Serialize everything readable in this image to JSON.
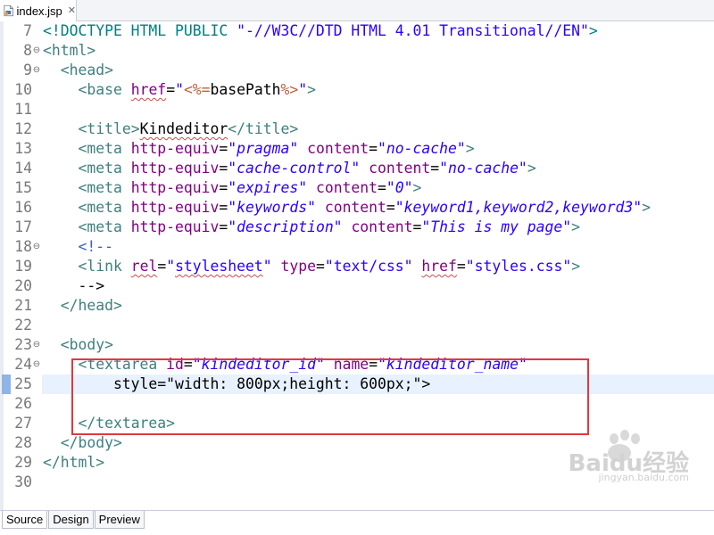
{
  "editor_tab": {
    "filename": "index.jsp",
    "icon": "jsp-file-icon"
  },
  "lines": [
    {
      "num": "7",
      "fold": "",
      "code": "<!DOCTYPE HTML PUBLIC \"-//W3C//DTD HTML 4.01 Transitional//EN\">"
    },
    {
      "num": "8",
      "fold": "⊖",
      "code": "<html>"
    },
    {
      "num": "9",
      "fold": "⊖",
      "code": "  <head>"
    },
    {
      "num": "10",
      "fold": "",
      "code": "    <base href=\"<%=basePath%>\">"
    },
    {
      "num": "11",
      "fold": "",
      "code": ""
    },
    {
      "num": "12",
      "fold": "",
      "code": "    <title>Kindeditor</title>"
    },
    {
      "num": "13",
      "fold": "",
      "code": "    <meta http-equiv=\"pragma\" content=\"no-cache\">"
    },
    {
      "num": "14",
      "fold": "",
      "code": "    <meta http-equiv=\"cache-control\" content=\"no-cache\">"
    },
    {
      "num": "15",
      "fold": "",
      "code": "    <meta http-equiv=\"expires\" content=\"0\">"
    },
    {
      "num": "16",
      "fold": "",
      "code": "    <meta http-equiv=\"keywords\" content=\"keyword1,keyword2,keyword3\">"
    },
    {
      "num": "17",
      "fold": "",
      "code": "    <meta http-equiv=\"description\" content=\"This is my page\">"
    },
    {
      "num": "18",
      "fold": "⊖",
      "code": "    <!--"
    },
    {
      "num": "19",
      "fold": "",
      "code": "    <link rel=\"stylesheet\" type=\"text/css\" href=\"styles.css\">"
    },
    {
      "num": "20",
      "fold": "",
      "code": "    -->"
    },
    {
      "num": "21",
      "fold": "",
      "code": "  </head>"
    },
    {
      "num": "22",
      "fold": "",
      "code": ""
    },
    {
      "num": "23",
      "fold": "⊖",
      "code": "  <body>"
    },
    {
      "num": "24",
      "fold": "⊖",
      "code": "    <textarea id=\"kindeditor_id\" name=\"kindeditor_name\""
    },
    {
      "num": "25",
      "fold": "",
      "code": "        style=\"width: 800px;height: 600px;\">"
    },
    {
      "num": "26",
      "fold": "",
      "code": ""
    },
    {
      "num": "27",
      "fold": "",
      "code": "    </textarea>"
    },
    {
      "num": "28",
      "fold": "",
      "code": "  </body>"
    },
    {
      "num": "29",
      "fold": "",
      "code": "</html>"
    },
    {
      "num": "30",
      "fold": "",
      "code": ""
    }
  ],
  "current_line": "25",
  "highlight_color": "#e0393e",
  "watermark": {
    "logo_text": "Baidu经验",
    "url_text": "jingyan.baidu.com"
  },
  "bottom_tabs": [
    {
      "label": "Source",
      "active": true
    },
    {
      "label": "Design",
      "active": false
    },
    {
      "label": "Preview",
      "active": false
    }
  ]
}
